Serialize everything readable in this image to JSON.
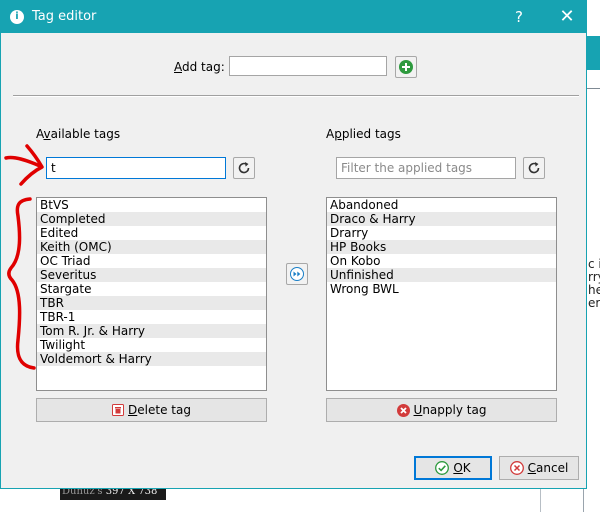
{
  "window": {
    "title": "Tag editor",
    "help_glyph": "?",
    "close_glyph": "✕"
  },
  "add_tag": {
    "label_mnemonic": "A",
    "label_rest": "dd tag:",
    "value": ""
  },
  "available": {
    "label_pre": "A",
    "label_mnemonic": "v",
    "label_post": "ailable tags",
    "filter_value": "t",
    "items": [
      "BtVS",
      "Completed",
      "Edited",
      "Keith (OMC)",
      "OC Triad",
      "Severitus",
      "Stargate",
      "TBR",
      "TBR-1",
      "Tom R. Jr. & Harry",
      "Twilight",
      "Voldemort & Harry"
    ]
  },
  "applied": {
    "label_pre": "A",
    "label_mnemonic": "p",
    "label_post": "plied tags",
    "filter_placeholder": "Filter the applied tags",
    "items": [
      "Abandoned",
      "Draco & Harry",
      "Drarry",
      "HP Books",
      "On Kobo",
      "Unfinished",
      "Wrong BWL"
    ]
  },
  "buttons": {
    "delete_mnemonic": "D",
    "delete_rest": "elete tag",
    "unapply_mnemonic": "U",
    "unapply_rest": "napply tag",
    "ok_mnemonic": "O",
    "ok_rest": "K",
    "cancel_mnemonic": "C",
    "cancel_rest": "ancel"
  },
  "background": {
    "text_lines": [
      "c i",
      "rry",
      "he",
      "er'"
    ],
    "caption_dim": "Dunuz's",
    "caption": "397 X 738"
  },
  "colors": {
    "title_bar": "#17a3b2",
    "annotation": "#e00000",
    "add_icon": "#2e9a3e",
    "delete_icon": "#d23b3b",
    "ok_icon": "#2e9a3e",
    "cancel_icon": "#d23b3b",
    "transfer_icon": "#1a7fc7"
  },
  "icons": {
    "add": "plus-circle-icon",
    "clear": "refresh-icon",
    "transfer": "double-arrow-icon",
    "delete": "trash-icon",
    "unapply": "x-circle-icon",
    "ok": "check-circle-icon",
    "cancel": "x-circle-icon"
  }
}
